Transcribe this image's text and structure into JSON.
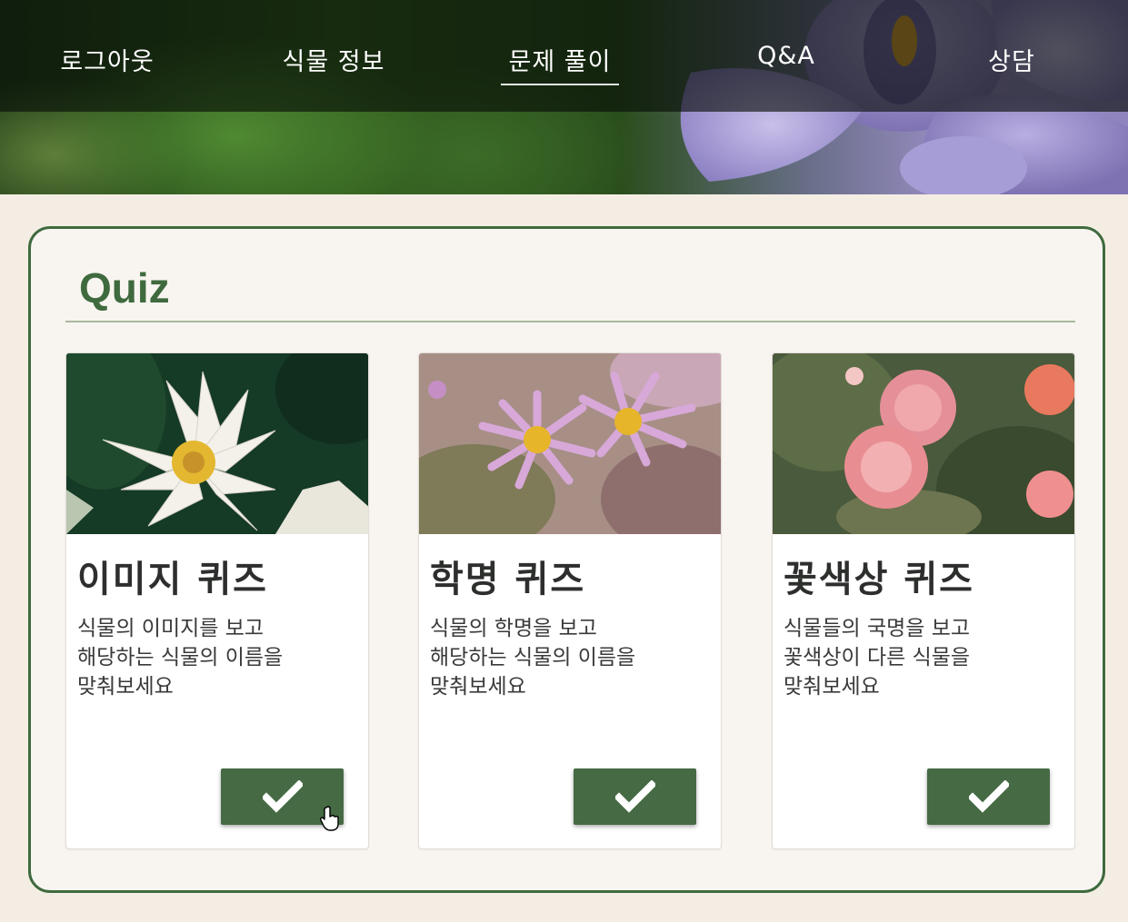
{
  "nav": {
    "items": [
      {
        "label": "로그아웃"
      },
      {
        "label": "식물 정보"
      },
      {
        "label": "문제 풀이",
        "active": true
      },
      {
        "label": "Q&A"
      },
      {
        "label": "상담"
      }
    ]
  },
  "quiz": {
    "title": "Quiz",
    "cards": [
      {
        "title": "이미지 퀴즈",
        "desc": [
          "식물의 이미지를 보고",
          "해당하는 식물의 이름을",
          "맞춰보세요"
        ],
        "image": "white-lotus-photo",
        "button_icon": "check-icon"
      },
      {
        "title": "학명 퀴즈",
        "desc": [
          "식물의 학명을 보고",
          "해당하는 식물의 이름을",
          "맞춰보세요"
        ],
        "image": "pink-daisy-photo",
        "button_icon": "check-icon"
      },
      {
        "title": "꽃색상 퀴즈",
        "desc": [
          "식물들의 국명을 보고",
          "꽃색상이 다른 식물을",
          "맞춰보세요"
        ],
        "image": "pink-rose-photo",
        "button_icon": "check-icon"
      }
    ]
  },
  "colors": {
    "accent": "#3f6a3e",
    "button": "#456a44",
    "page_bg": "#f4ede3"
  }
}
